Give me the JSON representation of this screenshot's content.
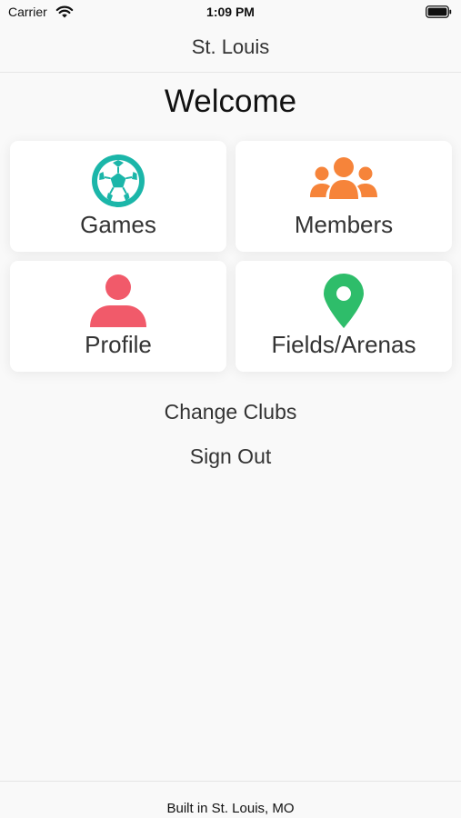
{
  "status_bar": {
    "carrier": "Carrier",
    "time": "1:09 PM"
  },
  "nav": {
    "title": "St. Louis"
  },
  "welcome": "Welcome",
  "tiles": [
    {
      "label": "Games",
      "icon": "soccer-ball-icon",
      "color": "#1bb6a9"
    },
    {
      "label": "Members",
      "icon": "group-icon",
      "color": "#f6843a"
    },
    {
      "label": "Profile",
      "icon": "person-icon",
      "color": "#f15a6a"
    },
    {
      "label": "Fields/Arenas",
      "icon": "map-pin-icon",
      "color": "#2ebd6a"
    }
  ],
  "actions": {
    "change_clubs": "Change Clubs",
    "sign_out": "Sign Out"
  },
  "footer": {
    "text": "Built in St. Louis, MO"
  }
}
